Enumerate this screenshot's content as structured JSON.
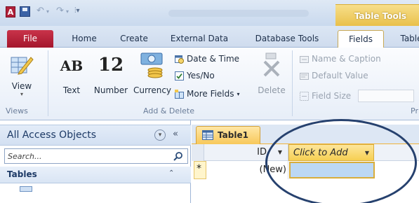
{
  "titlebar": {
    "app_icon": "A",
    "quick_access": [
      "save-icon",
      "undo-icon",
      "redo-icon",
      "customize-icon"
    ],
    "context_tab_group": "Table Tools"
  },
  "tabs": [
    "File",
    "Home",
    "Create",
    "External Data",
    "Database Tools",
    "Fields",
    "Table"
  ],
  "active_tab": "Fields",
  "ribbon": {
    "views": {
      "view_label": "View",
      "group_label": "Views"
    },
    "add_delete": {
      "text_glyph": "AB",
      "text_label": "Text",
      "number_glyph": "12",
      "number_label": "Number",
      "currency_label": "Currency",
      "date_time": "Date & Time",
      "yes_no": "Yes/No",
      "more_fields": "More Fields",
      "delete_label": "Delete",
      "group_label": "Add & Delete"
    },
    "properties": {
      "name_caption": "Name & Caption",
      "default_value": "Default Value",
      "field_size": "Field Size",
      "group_label_partial": "Pr"
    }
  },
  "nav": {
    "title": "All Access Objects",
    "search_placeholder": "Search...",
    "section": "Tables"
  },
  "document": {
    "tab_label": "Table1",
    "columns": [
      "ID",
      "Click to Add"
    ],
    "row": {
      "selector": "*",
      "id": "(New)"
    }
  },
  "colors": {
    "file_tab": "#b5213a",
    "context_gold": "#f0cb55",
    "highlight_ellipse": "#26416e",
    "selected_cell": "#bcd8f4"
  }
}
